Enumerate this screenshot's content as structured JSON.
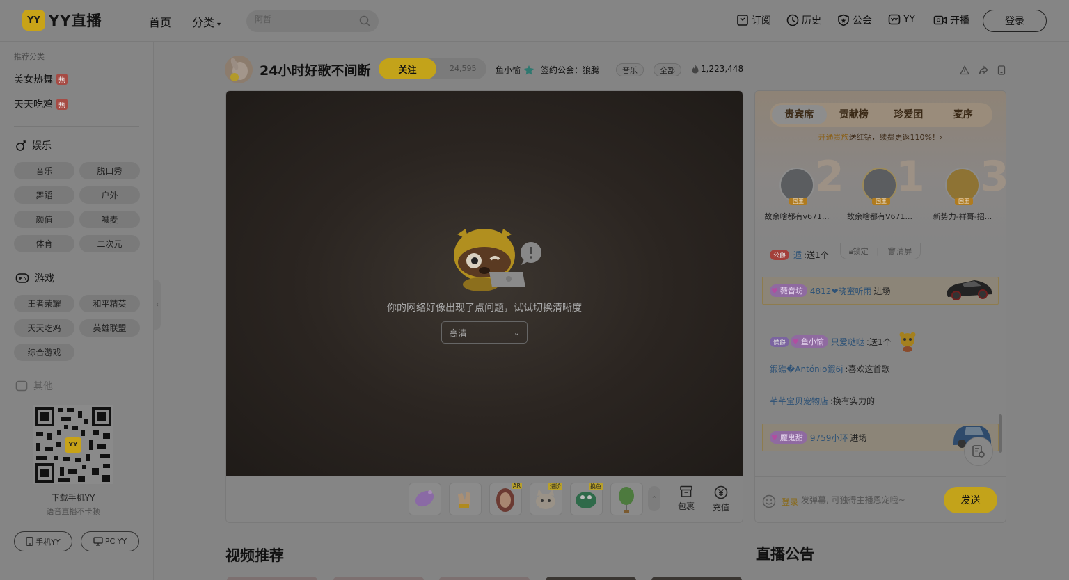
{
  "header": {
    "logo_mark": "YY",
    "logo_text": "YY直播",
    "nav": {
      "home": "首页",
      "category": "分类"
    },
    "search": {
      "placeholder": "阿哲"
    },
    "links": [
      "订阅",
      "历史",
      "公会",
      "YY",
      "开播"
    ],
    "login": "登录"
  },
  "sidebar": {
    "hint": "推荐分类",
    "hot_items": [
      {
        "label": "美女热舞",
        "badge": "热"
      },
      {
        "label": "天天吃鸡",
        "badge": "热"
      }
    ],
    "sections": [
      {
        "title": "娱乐",
        "tags": [
          "音乐",
          "脱口秀",
          "舞蹈",
          "户外",
          "颜值",
          "喊麦",
          "体育",
          "二次元"
        ]
      },
      {
        "title": "游戏",
        "tags": [
          "王者荣耀",
          "和平精英",
          "天天吃鸡",
          "英雄联盟",
          "综合游戏"
        ]
      },
      {
        "title": "其他",
        "tags": []
      }
    ],
    "download": {
      "qr_mark": "YY",
      "title": "下载手机YY",
      "subtitle": "语音直播不卡顿"
    },
    "app_buttons": [
      "手机YY",
      "PC YY"
    ]
  },
  "room": {
    "title": "24小时好歌不间断",
    "follow_label": "关注",
    "follow_count": "24,595",
    "anchor": "鱼小愉",
    "guild": "签约公会：狼腾一",
    "tags": [
      "音乐",
      "全部"
    ],
    "heat": "1,223,448"
  },
  "player": {
    "error_text": "你的网络好像出现了点问题，试试切换清晰度",
    "quality": "高清",
    "gifts": [
      {
        "name": "bubble-gift",
        "tag": ""
      },
      {
        "name": "clap-gift",
        "tag": ""
      },
      {
        "name": "ar-girl-gift",
        "tag": "AR"
      },
      {
        "name": "cat-gift",
        "tag": "进阶"
      },
      {
        "name": "dragon-gift",
        "tag": "换色"
      },
      {
        "name": "balloon-gift",
        "tag": ""
      }
    ],
    "actions": [
      "包裹",
      "充值"
    ]
  },
  "panel": {
    "tabs": [
      "贵宾席",
      "贡献榜",
      "珍爱团",
      "麦序"
    ],
    "promo_highlight": "开通贵族",
    "promo_text": "送红钻，续费更返110%！",
    "vips": [
      {
        "rank": "2",
        "name": "故余啥都有v671...",
        "badge": "国王"
      },
      {
        "rank": "1",
        "name": "故余啥都有V671...",
        "badge": "国王"
      },
      {
        "rank": "3",
        "name": "新势力-祥哥-招...",
        "badge": "国王"
      }
    ],
    "lock": "锁定",
    "clear": "清屏",
    "chat": [
      {
        "type": "gift",
        "badge": "公爵",
        "user": "遁",
        "text": ":送1个"
      },
      {
        "type": "enter",
        "fan": "薇音坊",
        "fan_level": "10",
        "user": "4812❤晓蜜听雨",
        "text": "进场"
      },
      {
        "type": "gift2",
        "badge": "侯爵",
        "fan": "鱼小愉",
        "user": "只爱哒哒",
        "text": ":送1个"
      },
      {
        "type": "msg",
        "user": "鍜礁�António鍜6j",
        "text": ":喜欢这首歌"
      },
      {
        "type": "msg",
        "user": "芊芊宝贝宠物店",
        "text": ":换有实力的"
      },
      {
        "type": "enter",
        "fan": "魔鬼甜",
        "fan_level": "6",
        "user": "9759小环",
        "text": "进场"
      }
    ],
    "input": {
      "login": "登录",
      "placeholder": "发弹幕, 可独得主播恩宠哦~",
      "send": "发送"
    }
  },
  "sections": {
    "video": "视频推荐",
    "notice": "直播公告"
  }
}
